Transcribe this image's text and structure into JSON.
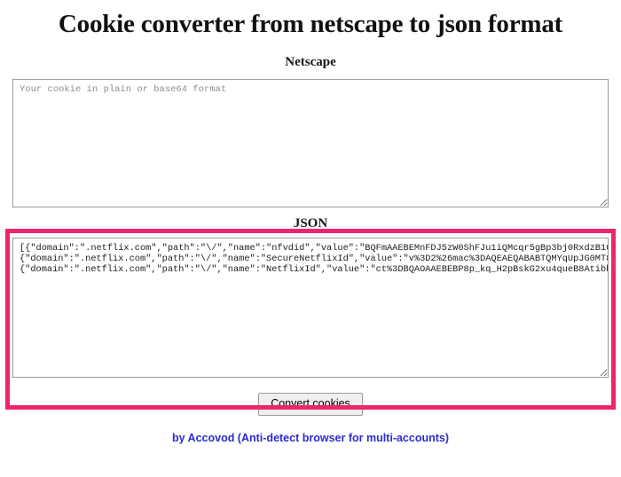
{
  "page": {
    "title": "Cookie converter from netscape to json format"
  },
  "netscape": {
    "label": "Netscape",
    "placeholder": "Your cookie in plain or base64 format",
    "value": ""
  },
  "json": {
    "label": "JSON",
    "highlight_color": "#f0246e",
    "value": "[{\"domain\":\".netflix.com\",\"path\":\"\\/\",\"name\":\"nfvdid\",\"value\":\"BQFmAAEBEMnFDJ5zW0ShFJu1iQMcqr5gBp3bj0RxdzB10z9Chg1spLMj8bD9YyGx5D9371qmu4VhGa4bT4GDib%2FD1qtLTh6QgxlvKdwQnG2tnptHtBm0zXVh4nM%2Bi8TEzCTVJ6O%2FWRzyirsA2JDq8%2BnPyK7AUu%2F%2B\"},\n{\"domain\":\".netflix.com\",\"path\":\"\\/\",\"name\":\"SecureNetflixId\",\"value\":\"v%3D2%26mac%3DAQEAEQABABTQMYqUpJG0MT8cwmyENtaU5xJdEOaLw5o.%26dt%3D1667457250850\"},\n{\"domain\":\".netflix.com\",\"path\":\"\\/\",\"name\":\"NetflixId\",\"value\":\"ct%3DBQAOAAEBEBP8p_kq_H2pBskG2xu4queB8Atibbwyo7N_Q5PSPqwzCURDKDV0caPMLJGYrD-yNcPB87qvRedXH7UdWeMeYdQwOuqZ2D_dpBkSUJ0rBRJ8-VIR4T95rAyigKy0TT6qkAums2XPW7GP0CqwzjqQmefU57qlfsWtMWg9l4H959nmAQoaWx_l1U5oGk4dQG4Xk4MJmi_n320odBQL0mHHxpYsaQQoYHNoa_ReJYI7NHBg5wMT1jZwaPnMD5EqeVHX5PNKfvQnRdJPlPDBbZPA99LzjB_19XCf9XG"
  },
  "actions": {
    "convert_label": "Convert cookies"
  },
  "footer": {
    "text": "by Accovod (Anti-detect browser for multi-accounts)",
    "link_label": "by Accovod (Anti-detect browser for multi-accounts)"
  }
}
